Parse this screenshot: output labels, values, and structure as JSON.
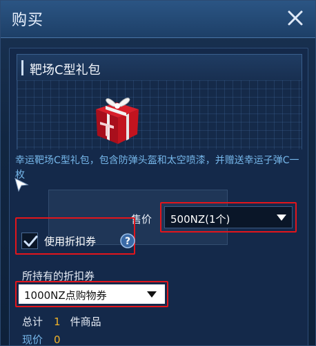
{
  "window": {
    "title": "购买"
  },
  "product": {
    "name": "靶场C型礼包",
    "description": "幸运靶场C型礼包，包含防弹头盔和太空喷漆，并赠送幸运子弹C一枚"
  },
  "purchase": {
    "price_label": "售价",
    "price_selected": "500NZ(1个)",
    "use_coupon_label": "使用折扣券",
    "use_coupon_checked": true,
    "owned_coupons_label": "所持有的折扣券",
    "coupon_selected": "1000NZ点购物券"
  },
  "summary": {
    "total_prefix": "总计",
    "total_count": "1",
    "total_suffix": "件商品",
    "now_price_label": "现价",
    "now_price_value": "0"
  },
  "colors": {
    "accent_red": "#e3151b",
    "highlight_blue": "#76b7ea",
    "number_gold": "#f2b428"
  }
}
